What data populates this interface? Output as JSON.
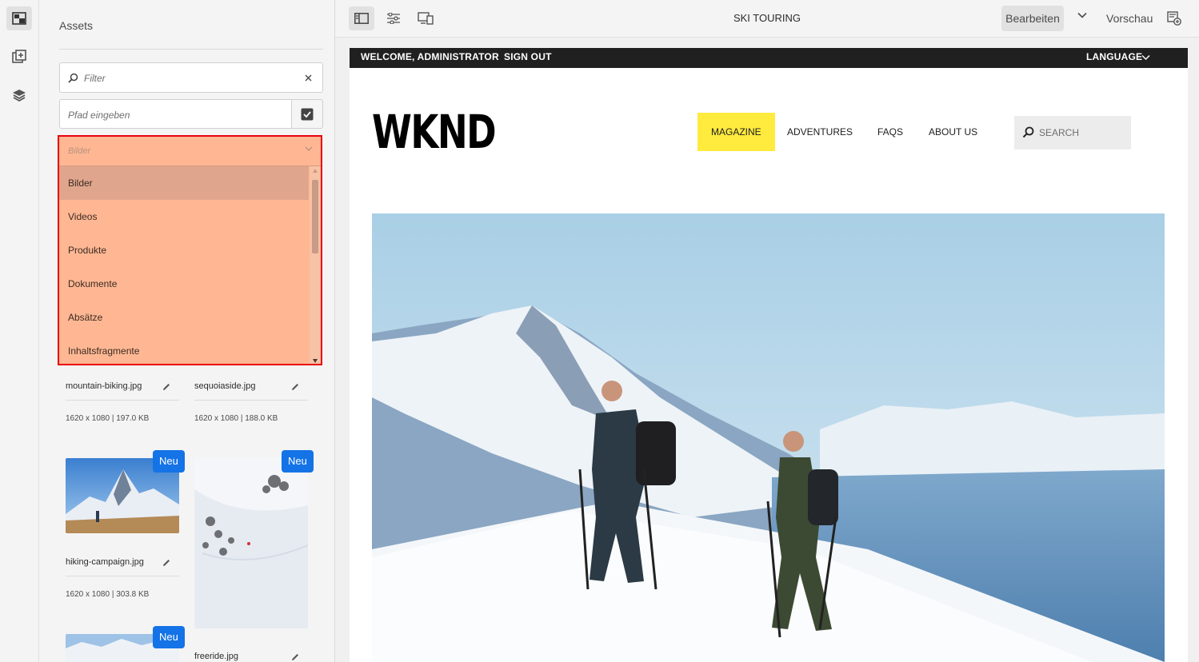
{
  "rail": {
    "items": [
      {
        "icon": "assets-icon",
        "active": true
      },
      {
        "icon": "components-icon",
        "active": false
      },
      {
        "icon": "content-tree-icon",
        "active": false
      }
    ]
  },
  "panel": {
    "title": "Assets",
    "filter": {
      "placeholder": "Filter"
    },
    "path": {
      "placeholder": "Pfad eingeben"
    },
    "type_select": {
      "selected": "Bilder",
      "options": [
        "Bilder",
        "Videos",
        "Produkte",
        "Dokumente",
        "Absätze",
        "Inhaltsfragmente"
      ]
    },
    "assets": [
      {
        "name": "mountain-biking.jpg",
        "meta": "1620 x 1080 | 197.0 KB"
      },
      {
        "name": "sequoiaside.jpg",
        "meta": "1620 x 1080 | 188.0 KB"
      },
      {
        "name": "hiking-campaign.jpg",
        "meta": "1620 x 1080 | 303.8 KB",
        "badge": "Neu"
      },
      {
        "name": "freeride.jpg",
        "badge": "Neu"
      },
      {
        "name": "",
        "badge": "Neu"
      }
    ]
  },
  "topbar": {
    "page_title": "SKI TOURING",
    "mode": "Bearbeiten",
    "preview": "Vorschau"
  },
  "site": {
    "welcome": "WELCOME, ADMINISTRATOR",
    "signout": "SIGN OUT",
    "language": "LANGUAGE",
    "logo": "WKND",
    "nav": [
      "MAGAZINE",
      "ADVENTURES",
      "FAQS",
      "ABOUT US"
    ],
    "search_placeholder": "SEARCH"
  },
  "colors": {
    "accent": "#1473e6",
    "highlight": "#ffea3e",
    "dropdown_overlay": "#ffb793",
    "dropdown_border": "#e8000e"
  }
}
